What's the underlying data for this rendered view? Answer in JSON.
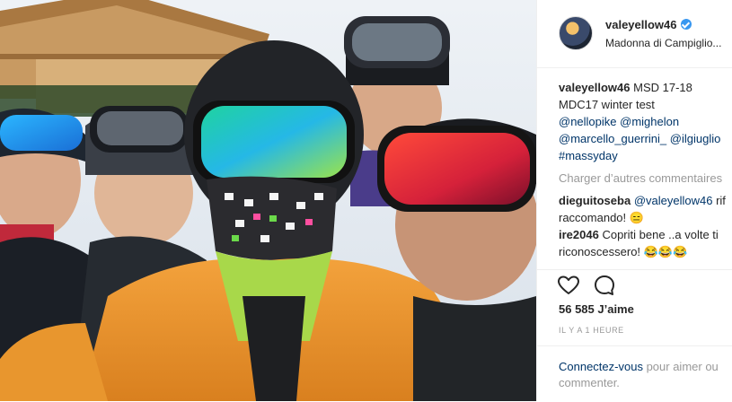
{
  "post": {
    "username": "valeyellow46",
    "location": "Madonna di Campiglio..."
  },
  "caption": {
    "username": "valeyellow46",
    "line1": "MSD 17-18",
    "line2": "MDC17 winter test",
    "line3_a": "@nellopike",
    "line3_b": "@mighelon",
    "line4_a": "@marcello_guerrini_",
    "line4_b": "@ilgiuglio",
    "line5": "#massyday"
  },
  "load_more": "Charger d’autres commentaires",
  "comments": [
    {
      "user": "dieguitoseba",
      "mention": "@valeyellow46",
      "text_a": "rif",
      "text_b": "raccomando! 😑"
    },
    {
      "user": "ire2046",
      "text_a": "Copriti bene ..a volte ti",
      "text_b": "riconoscessero! 😂😂😂"
    }
  ],
  "likes": "56 585 J’aime",
  "time": "IL Y A 1 HEURE",
  "login": {
    "link": "Connectez-vous",
    "rest_a": " pour aimer ou",
    "rest_b": "commenter."
  },
  "icons": [
    "heart-icon",
    "comment-icon",
    "verified-badge-icon"
  ],
  "colors": {
    "link": "#003569",
    "muted": "#999999",
    "verified": "#3897f0",
    "text": "#262626"
  }
}
